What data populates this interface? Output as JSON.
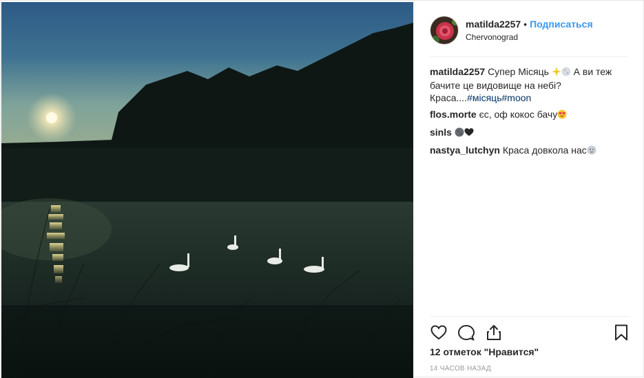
{
  "post": {
    "author": {
      "username": "matilda2257",
      "separator": "•",
      "follow_label": "Подписаться",
      "location": "Chervonograd"
    },
    "caption": {
      "username": "matilda2257",
      "text": "Супер Місяць",
      "text2": "А ви теж бачите це видовище на небі? Краса....",
      "hashtags": [
        "#місяць",
        "#moon"
      ],
      "emojis": [
        "sparkles",
        "full-moon"
      ]
    },
    "comments": [
      {
        "username": "flos.morte",
        "text": "єс, оф кокос бачу",
        "emojis": [
          "heart-eyes"
        ]
      },
      {
        "username": "sinls",
        "text": "",
        "emojis": [
          "new-moon",
          "black-heart"
        ]
      },
      {
        "username": "nastya_lutchyn",
        "text": "Краса довкола нас",
        "emojis": [
          "moon-face"
        ]
      }
    ],
    "likes_label": "12 отметок \"Нравится\"",
    "timestamp": "14 часов назад",
    "icons": [
      "heart-icon",
      "comment-icon",
      "share-icon",
      "bookmark-icon"
    ],
    "colors": {
      "link": "#3897f0",
      "hashtag": "#003569",
      "text": "#262626",
      "muted": "#999999"
    }
  }
}
